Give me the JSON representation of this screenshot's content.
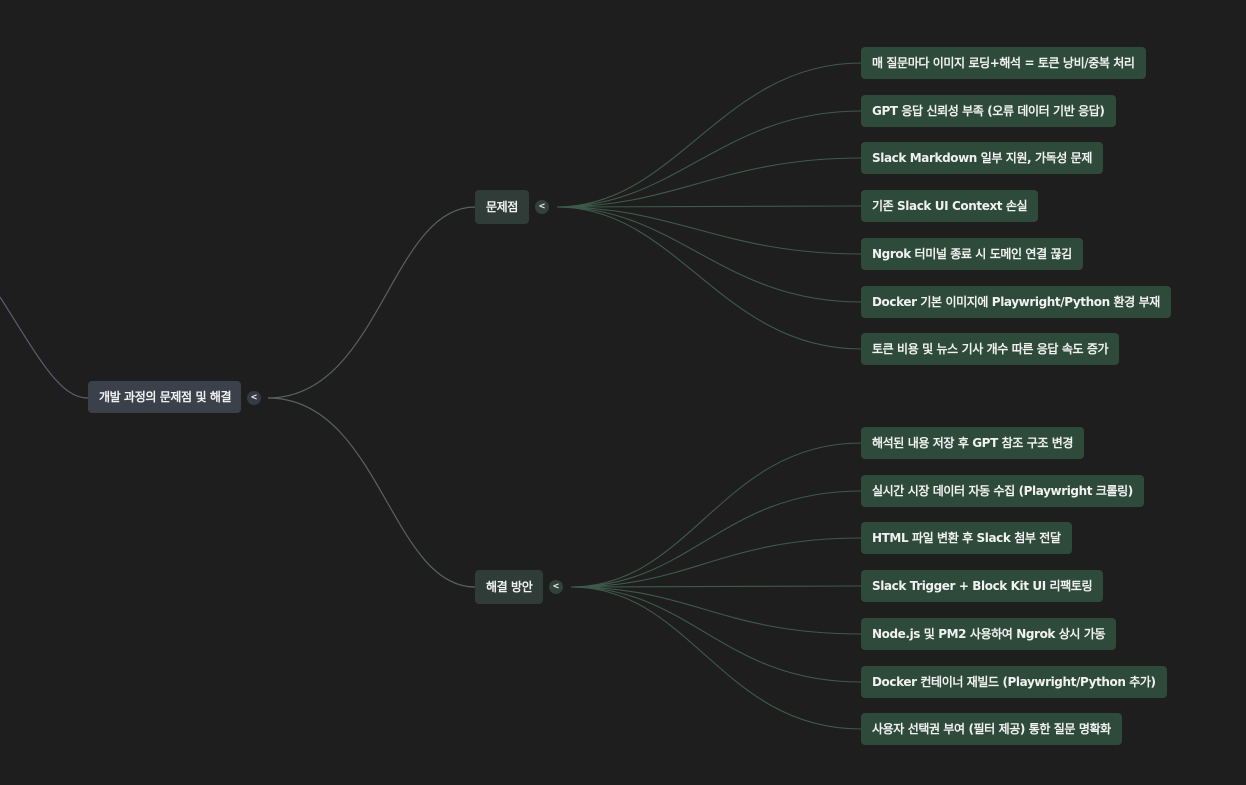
{
  "root": {
    "label": "개발 과정의 문제점 및 해결",
    "toggle": "<"
  },
  "branches": [
    {
      "label": "문제점",
      "toggle": "<",
      "children": [
        "매 질문마다 이미지 로딩+해석 = 토큰 낭비/중복 처리",
        "GPT 응답 신뢰성 부족 (오류 데이터 기반 응답)",
        "Slack Markdown 일부 지원, 가독성 문제",
        "기존 Slack UI Context 손실",
        "Ngrok 터미널 종료 시 도메인 연결 끊김",
        "Docker 기본 이미지에 Playwright/Python 환경 부재",
        "토큰 비용 및 뉴스 기사 개수 따른 응답 속도 증가"
      ]
    },
    {
      "label": "해결 방안",
      "toggle": "<",
      "children": [
        "해석된 내용 저장 후 GPT 참조 구조 변경",
        "실시간 시장 데이터 자동 수집 (Playwright 크롤링)",
        "HTML 파일 변환 후 Slack 첨부 전달",
        "Slack Trigger + Block Kit UI 리팩토링",
        "Node.js 및 PM2 사용하여 Ngrok 상시 가동",
        "Docker 컨테이너 재빌드 (Playwright/Python 추가)",
        "사용자 선택권 부여 (필터 제공) 통한 질문 명확화"
      ]
    }
  ],
  "colors": {
    "background": "#1e1e1e",
    "root_node": "#3a414b",
    "branch_node": "#2f3c38",
    "leaf_node": "#2e4a3b",
    "edge_root": "#5a5f6e",
    "edge_leaf": "#3f5a4b"
  }
}
